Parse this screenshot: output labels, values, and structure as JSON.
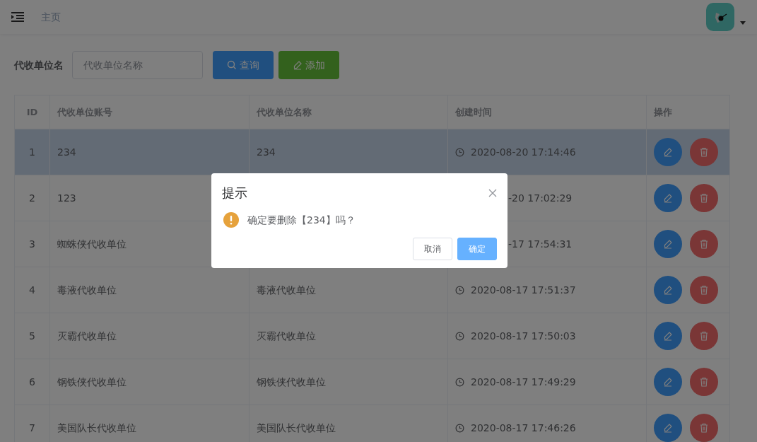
{
  "header": {
    "breadcrumb": "主页"
  },
  "search": {
    "label": "代收单位名",
    "placeholder": "代收单位名称",
    "buttons": [
      {
        "kind": "search",
        "label": "查询"
      },
      {
        "kind": "add",
        "label": "添加"
      }
    ]
  },
  "table": {
    "columns": [
      "ID",
      "代收单位账号",
      "代收单位名称",
      "创建时间",
      "操作"
    ],
    "rows": [
      {
        "id": "1",
        "account": "234",
        "name": "234",
        "time": "2020-08-20 17:14:46",
        "kind": "full",
        "selected": true
      },
      {
        "id": "2",
        "account": "123",
        "time": "-20 17:02:29",
        "kind": "partial",
        "selected": false
      },
      {
        "id": "3",
        "account": "蜘蛛侠代收单位",
        "time": "-17 17:54:31",
        "kind": "partial",
        "selected": false
      },
      {
        "id": "4",
        "account": "毒液代收单位",
        "name": "毒液代收单位",
        "time": "2020-08-17 17:51:37",
        "kind": "full",
        "selected": false
      },
      {
        "id": "5",
        "account": "灭霸代收单位",
        "name": "灭霸代收单位",
        "time": "2020-08-17 17:50:03",
        "kind": "full",
        "selected": false
      },
      {
        "id": "6",
        "account": "钢铁侠代收单位",
        "name": "钢铁侠代收单位",
        "time": "2020-08-17 17:49:29",
        "kind": "full",
        "selected": false
      },
      {
        "id": "7",
        "account": "美国队长代收单位",
        "name": "美国队长代收单位",
        "time": "2020-08-17 17:46:26",
        "kind": "full",
        "selected": false
      }
    ]
  },
  "dialog": {
    "title": "提示",
    "message": "确定要删除【234】吗？",
    "buttons": [
      {
        "kind": "cancel",
        "label": "取消"
      },
      {
        "kind": "confirm",
        "label": "确定"
      }
    ]
  }
}
